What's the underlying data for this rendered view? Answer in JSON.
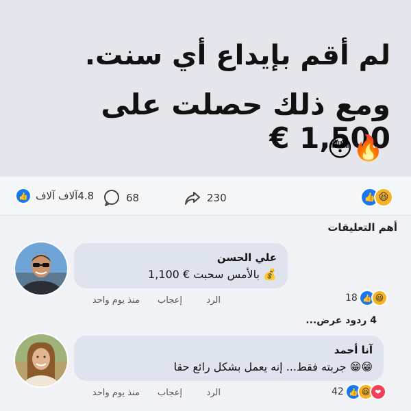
{
  "post": {
    "line1": "لم أقم بإيداع أي سنت.",
    "line2": "ومع ذلك حصلت على 1,500 €",
    "emojis": "🔥😳"
  },
  "stats": {
    "shares": "230",
    "comments": "68",
    "reactions": "4.8آلاف آلاف"
  },
  "section_title": "أهم التعليقات",
  "comments": [
    {
      "name": "علي الحسن",
      "text": "💰 بالأمس سحبت € 1,100",
      "reply": "الرد",
      "like": "إعجاب",
      "time": "منذ يوم واحد",
      "reaction_count": "18"
    },
    {
      "name": "آنا أحمد",
      "text": "😁😁 جربته فقط... إنه يعمل بشكل رائع حقا",
      "reply": "الرد",
      "like": "إعجاب",
      "time": "منذ يوم واحد",
      "reaction_count": "42"
    }
  ],
  "replies_link": "4 ردود عرض...",
  "colors": {
    "accent": "#1877f2",
    "bubble": "#dfe3ee",
    "hero_bg": "#e4e6eb"
  }
}
